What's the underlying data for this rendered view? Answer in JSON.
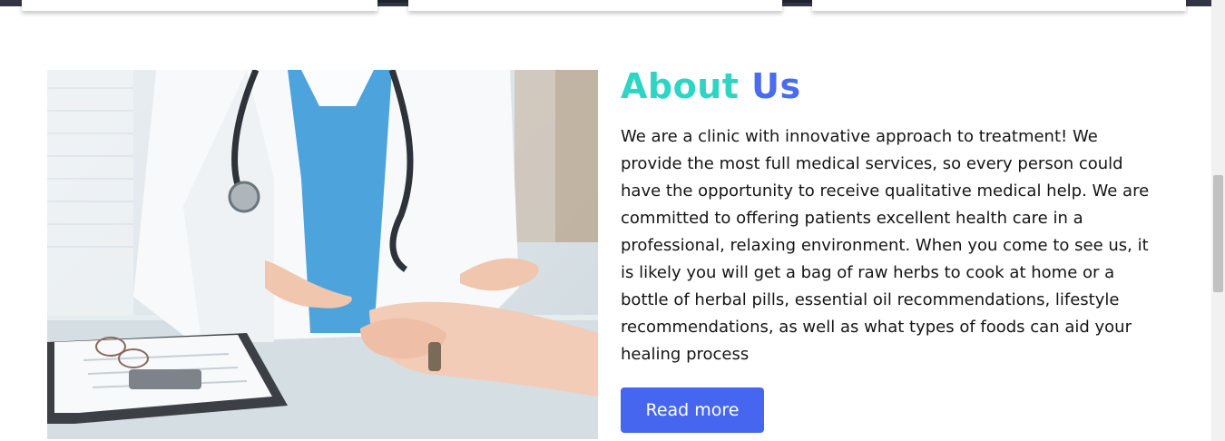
{
  "about": {
    "title_part1": "About",
    "title_part2": "Us",
    "paragraph": "We are a clinic with innovative approach to treatment! We provide the most full medical services, so every person could have the opportunity to receive qualitative medical help. We are committed to offering patients excellent health care in a professional, relaxing environment. When you come to see us, it is likely you will get a bag of raw herbs to cook at home or a bottle of herbal pills, essential oil recommendations, lifestyle recommendations, as well as what types of foods can aid your healing process",
    "button_label": "Read more"
  },
  "colors": {
    "title_teal": "#2fd5c4",
    "title_blue": "#4a6cf0",
    "button": "#4766ef"
  }
}
